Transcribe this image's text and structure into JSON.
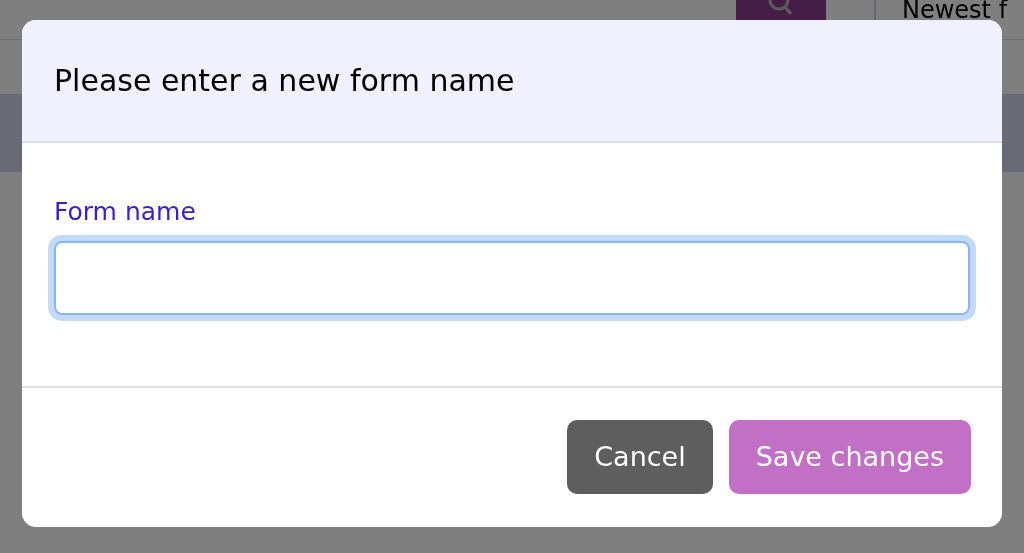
{
  "background": {
    "sort_label": "Newest f"
  },
  "dialog": {
    "title": "Please enter a new form name",
    "field": {
      "label": "Form name",
      "focused": true
    },
    "buttons": [
      {
        "label": "Cancel",
        "kind": "secondary"
      },
      {
        "label": "Save changes",
        "kind": "primary"
      }
    ]
  }
}
